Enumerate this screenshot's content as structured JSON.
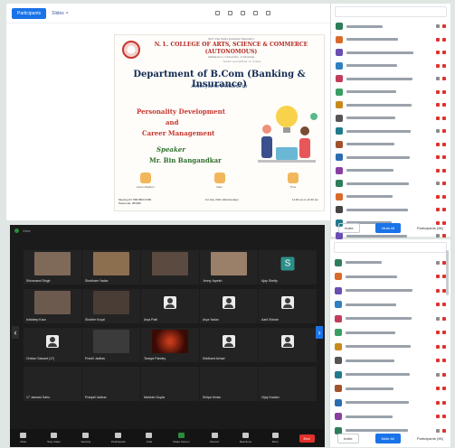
{
  "toolbar": {
    "primary_label": "Participants",
    "tab_label": "Slides"
  },
  "poster": {
    "line1": "Shri Vile Parle Kelavani Mandal's",
    "college": "N. L. COLLEGE OF ARTS, SCIENCE & COMMERCE",
    "autonomous": "(AUTONOMOUS)",
    "line4": "Affiliated to University of Mumbai",
    "line5": "NAAC Accredited 'A' Grade",
    "department": "Department of B.Com (Banking & Insurance)",
    "invite": "invites you for a Webinar on",
    "topic1": "Personality Development",
    "topic2": "and",
    "topic3": "Career Management",
    "speaker_label": "Speaker",
    "speaker_name": "Mr. Bin Bangandkar",
    "info": [
      "Zoom Platform",
      "Date",
      "Time"
    ],
    "meeting_id": "Meeting ID: 868 8863 0399",
    "passcode": "Passcode: 283366",
    "date": "1st July, 2021 (Wednesday)",
    "time": "11:00 am to 12:30 pm"
  },
  "panel_top": {
    "footer_left": "Invite",
    "footer_btn": "Mute All",
    "footer_right": "Participants (96)",
    "rows": 17
  },
  "gallery": {
    "top_label": "View",
    "tiles": [
      "Shivanand Singh",
      "Shubham Yadav",
      "",
      "Jenny Jayesh",
      "Ajay Shetty",
      "Ishtdeep Kaur",
      "Shobhe Koyal",
      "Arya Patil",
      "Arya Yadav",
      "Aarti Shinde",
      "Chetan Sawant (17)",
      "Prachi Jadhav",
      "Tanaya Pandey",
      "Siddhant Avhad",
      "",
      "17 Janhavi Sahu",
      "Pranjali Jadhav",
      "Mahesh Gupta",
      "Shilpa Kedar",
      "Vijay Kadam"
    ],
    "controls": [
      "Mute",
      "Stop Video",
      "Security",
      "Participants",
      "Chat",
      "Share Screen",
      "Record",
      "Reactions",
      "More"
    ],
    "end_label": "End"
  },
  "colors": {
    "accent": "#1a73e8",
    "poster_red": "#c7372f",
    "poster_navy": "#122a52",
    "poster_green": "#2f6f2c",
    "end_red": "#e0312b"
  }
}
